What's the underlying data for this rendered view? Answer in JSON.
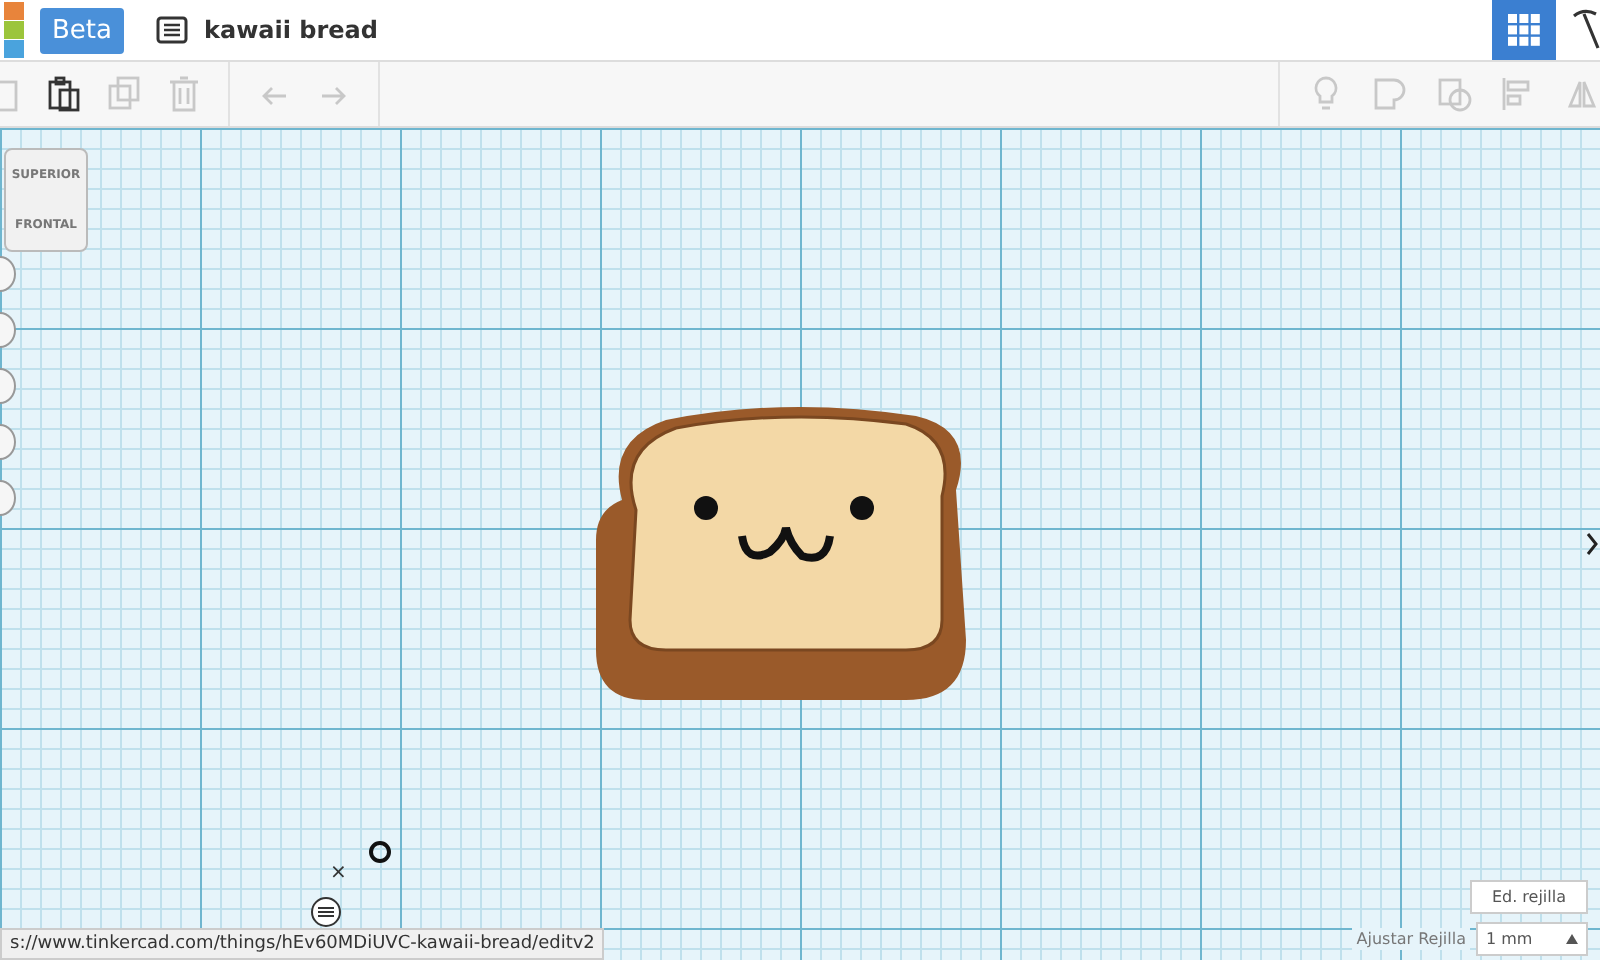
{
  "header": {
    "badge": "Beta",
    "title": "kawaii bread",
    "grid_view_selected": true
  },
  "toolbar": {
    "left": [
      {
        "kind": "clipboard",
        "disabled": true
      },
      {
        "kind": "paste",
        "disabled": false
      },
      {
        "kind": "duplicate",
        "disabled": true
      },
      {
        "kind": "trash",
        "disabled": true
      },
      {
        "kind": "undo",
        "disabled": true
      },
      {
        "kind": "redo",
        "disabled": true
      }
    ],
    "right": [
      {
        "kind": "bulb",
        "disabled": true
      },
      {
        "kind": "shape",
        "disabled": true
      },
      {
        "kind": "hole",
        "disabled": true
      },
      {
        "kind": "align",
        "disabled": true
      },
      {
        "kind": "mirror",
        "disabled": true
      }
    ]
  },
  "view_cube": {
    "top": "SUPERIOR",
    "front": "FRONTAL"
  },
  "grid": {
    "edit_button": "Ed. rejilla",
    "snap_label": "Ajustar Rejilla",
    "snap_value": "1 mm"
  },
  "close_mark": "×",
  "status_url": "s://www.tinkercad.com/things/hEv60MDiUVC-kawaii-bread/editv2"
}
